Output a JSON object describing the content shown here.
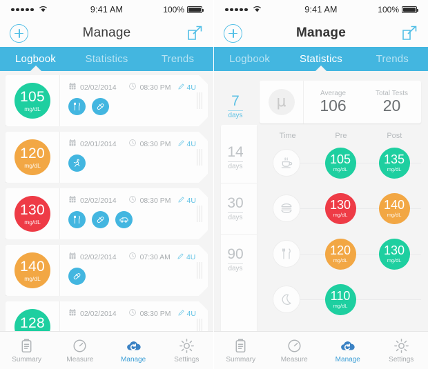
{
  "accent": {
    "blue": "#43b6e0",
    "blue_text": "#5ec1e4",
    "green": "#1ecfa0",
    "orange": "#f2a744",
    "red": "#ee3b46",
    "grey_text": "#b6babd"
  },
  "status_bar": {
    "signal": "•••••",
    "wifi_icon": "wifi-icon",
    "time": "9:41 AM",
    "battery_percent": "100%",
    "battery_icon": "battery-full-icon"
  },
  "nav": {
    "add_icon": "plus-circle-icon",
    "title": "Manage",
    "share_icon": "share-external-icon"
  },
  "tabs": [
    {
      "label": "Logbook"
    },
    {
      "label": "Statistics"
    },
    {
      "label": "Trends"
    }
  ],
  "left_screen": {
    "active_tab": "Logbook",
    "logbook": {
      "unit": "mg/dL",
      "date_icon": "calendar-icon",
      "time_icon": "clock-icon",
      "dose_icon": "pencil-icon",
      "entries": [
        {
          "value": "105",
          "unit": "mg/dL",
          "color": "#1ecfa0",
          "date": "02/02/2014",
          "time": "08:30 PM",
          "dose": "4U",
          "tags": [
            {
              "icon": "cutlery-icon"
            },
            {
              "icon": "pill-icon"
            }
          ]
        },
        {
          "value": "120",
          "unit": "mg/dL",
          "color": "#f2a744",
          "date": "02/01/2014",
          "time": "08:30 PM",
          "dose": "4U",
          "tags": [
            {
              "icon": "running-icon"
            }
          ]
        },
        {
          "value": "130",
          "unit": "mg/dL",
          "color": "#ee3b46",
          "date": "02/02/2014",
          "time": "08:30 PM",
          "dose": "4U",
          "tags": [
            {
              "icon": "cutlery-icon"
            },
            {
              "icon": "pill-icon"
            },
            {
              "icon": "car-icon"
            }
          ]
        },
        {
          "value": "140",
          "unit": "mg/dL",
          "color": "#f2a744",
          "date": "02/02/2014",
          "time": "07:30 AM",
          "dose": "4U",
          "tags": [
            {
              "icon": "pill-icon"
            }
          ]
        },
        {
          "value": "128",
          "unit": "mg/dL",
          "color": "#1ecfa0",
          "date": "02/02/2014",
          "time": "08:30 PM",
          "dose": "4U",
          "tags": []
        }
      ]
    }
  },
  "right_screen": {
    "active_tab": "Statistics",
    "day_ranges": [
      {
        "number": "7",
        "unit": "days",
        "active": true
      },
      {
        "number": "14",
        "unit": "days",
        "active": false
      },
      {
        "number": "30",
        "unit": "days",
        "active": false
      },
      {
        "number": "90",
        "unit": "days",
        "active": false
      }
    ],
    "summary": {
      "avatar_icon": "mu-average-icon",
      "avatar_glyph": "μ",
      "average_label": "Average",
      "average_value": "106",
      "total_label": "Total Tests",
      "total_value": "20"
    },
    "table": {
      "headers": [
        "Time",
        "Pre",
        "Post"
      ],
      "unit": "mg/dL",
      "rows": [
        {
          "time_icon": "coffee-cup-icon",
          "pre": "105",
          "pre_color": "#1ecfa0",
          "post": "135",
          "post_color": "#1ecfa0"
        },
        {
          "time_icon": "burger-icon",
          "pre": "130",
          "pre_color": "#ee3b46",
          "post": "140",
          "post_color": "#f2a744"
        },
        {
          "time_icon": "cutlery-icon",
          "pre": "120",
          "pre_color": "#f2a744",
          "post": "130",
          "post_color": "#1ecfa0"
        },
        {
          "time_icon": "moon-icon",
          "pre": "110",
          "pre_color": "#1ecfa0",
          "post": "",
          "post_color": ""
        }
      ]
    }
  },
  "tabbar": [
    {
      "label": "Summary",
      "icon": "clipboard-icon",
      "active": false
    },
    {
      "label": "Measure",
      "icon": "gauge-icon",
      "active": false
    },
    {
      "label": "Manage",
      "icon": "cloud-sync-icon",
      "active": true
    },
    {
      "label": "Settings",
      "icon": "gear-icon",
      "active": false
    }
  ]
}
